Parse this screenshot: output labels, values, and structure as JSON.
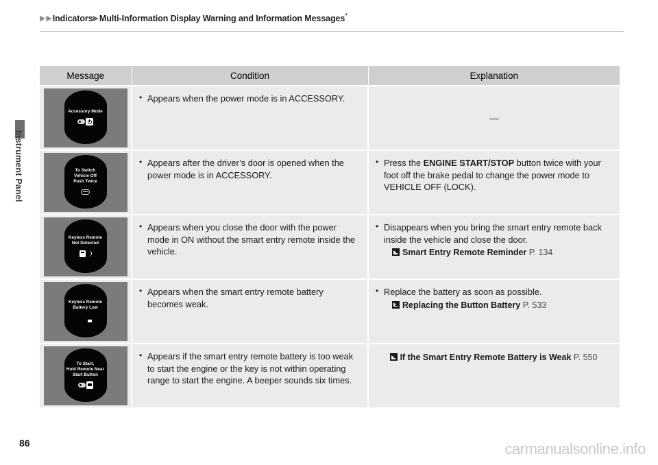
{
  "breadcrumb": {
    "arrow1": "▶",
    "arrow2": "▶",
    "item1": "Indicators",
    "arrow3": "▶",
    "item2": "Multi-Information Display Warning and Information Messages",
    "footnote_marker": "*"
  },
  "sidebar": {
    "chapter_label": "Instrument Panel"
  },
  "table": {
    "headers": [
      "Message",
      "Condition",
      "Explanation"
    ],
    "rows": [
      {
        "display_text": "Accessory Mode",
        "display_icons": [
          "key-icon",
          "power-button-icon"
        ],
        "condition": "Appears when the power mode is in ACCESSORY.",
        "explanation_dash": "—",
        "explanation": "",
        "explanation_bold": "",
        "explanation_tail": "",
        "reference": null
      },
      {
        "display_text": "To Switch\nVehicle Off\nPush Twice",
        "display_icons": [
          "oval-button-icon"
        ],
        "condition": "Appears after the driver’s door is opened when the power mode is in ACCESSORY.",
        "explanation_lead": "Press the ",
        "explanation_bold": "ENGINE START/STOP",
        "explanation_tail": " button twice with your foot off the brake pedal to change the power mode to VEHICLE OFF (LOCK).",
        "reference": null
      },
      {
        "display_text": "Keyless Remote\nNot Detected",
        "display_icons": [
          "remote-icon",
          "signal-wave-icon"
        ],
        "condition": "Appears when you close the door with the power mode in ON without the smart entry remote inside the vehicle.",
        "explanation_lead": "Disappears when you bring the smart entry remote back inside the vehicle and close the door.",
        "explanation_bold": "",
        "explanation_tail": "",
        "reference": {
          "icon": "reference-arrow-icon",
          "title": "Smart Entry Remote Reminder",
          "page": "P. 134",
          "centered": false
        }
      },
      {
        "display_text": "Keyless Remote\nBattery Low",
        "display_icons": [
          "battery-low-icon"
        ],
        "condition": "Appears when the smart entry remote battery becomes weak.",
        "explanation_lead": "Replace the battery as soon as possible.",
        "explanation_bold": "",
        "explanation_tail": "",
        "reference": {
          "icon": "reference-arrow-icon",
          "title": "Replacing the Button Battery",
          "page": "P. 533",
          "centered": false
        }
      },
      {
        "display_text": "To Start,\nHold Remote Near\nStart Button",
        "display_icons": [
          "key-icon",
          "hand-remote-icon"
        ],
        "condition": "Appears if the smart entry remote battery is too weak to start the engine or the key is not within operating range to start the engine. A beeper sounds six times.",
        "explanation_lead": "",
        "explanation_bold": "",
        "explanation_tail": "",
        "reference": {
          "icon": "reference-arrow-icon",
          "title": "If the Smart Entry Remote Battery is Weak",
          "page": "P. 550",
          "centered": true
        }
      }
    ]
  },
  "footer": {
    "page_number": "86",
    "watermark": "carmanualsonline.info"
  },
  "colors": {
    "header_fill": "#cfcfcf",
    "cell_fill": "#ebebeb",
    "display_bezel": "#7b7b7b",
    "display_screen": "#050505",
    "rule": "#a7a7a7",
    "tab": "#6e6e6e",
    "watermark": "#c9c9c9"
  }
}
